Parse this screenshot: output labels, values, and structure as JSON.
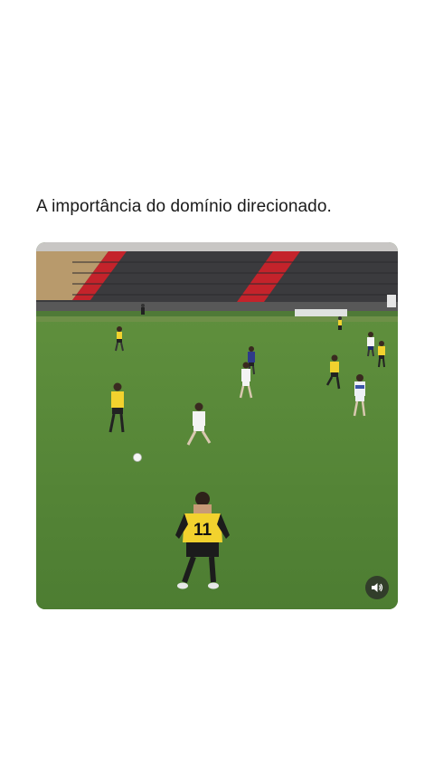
{
  "post": {
    "caption": "A importância do domínio direcionado."
  },
  "video": {
    "jersey_number": "11",
    "audio_icon": "speaker-icon"
  },
  "colors": {
    "pitch": "#5a8a3c",
    "home_kit": "#f2d22e",
    "away_kit": "#f3f3f3",
    "stands_seats": "#3a3a3d",
    "stand_stairs": "#c4232b"
  }
}
